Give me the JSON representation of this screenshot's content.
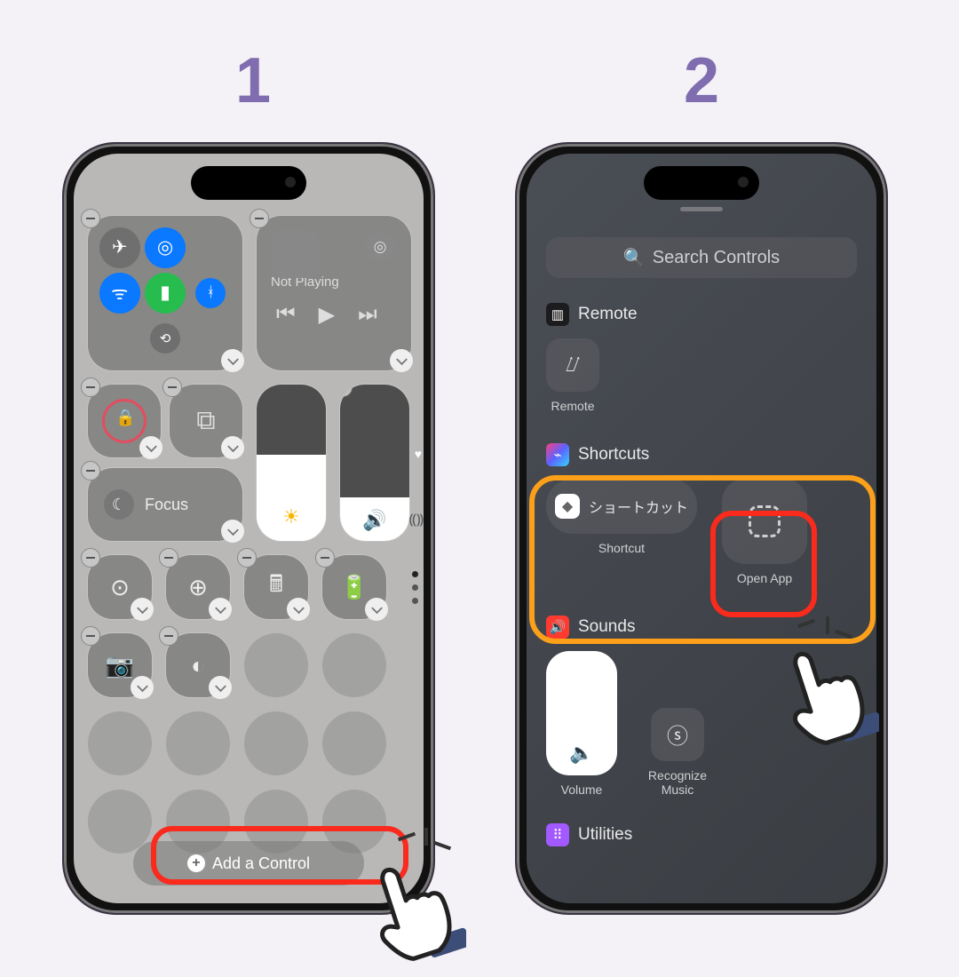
{
  "steps": {
    "one": "1",
    "two": "2"
  },
  "colors": {
    "accent_purple": "#7f6daf",
    "highlight_red": "#fa2a1c",
    "highlight_orange": "#fca01a",
    "ios_blue": "#0a78ff"
  },
  "phone1": {
    "media": {
      "state": "Not Playing"
    },
    "focus_label": "Focus",
    "connectivity": {
      "airplane": "airplane-icon",
      "airdrop": "airdrop-icon",
      "wifi": "wifi-icon",
      "cellular": "cellular-icon",
      "bluetooth": "bluetooth-icon",
      "hotspot": "hotspot-icon"
    },
    "add_control": "Add a Control"
  },
  "phone2": {
    "search_placeholder": "Search Controls",
    "sections": {
      "remote": {
        "title": "Remote",
        "items": [
          {
            "label": "Remote"
          }
        ]
      },
      "shortcuts": {
        "title": "Shortcuts",
        "items": [
          {
            "label": "Shortcut",
            "tile_text": "ショートカット"
          },
          {
            "label": "Open App"
          }
        ]
      },
      "sounds": {
        "title": "Sounds",
        "items": [
          {
            "label": "Volume"
          },
          {
            "label": "Recognize Music"
          }
        ]
      },
      "utilities": {
        "title": "Utilities"
      }
    }
  }
}
